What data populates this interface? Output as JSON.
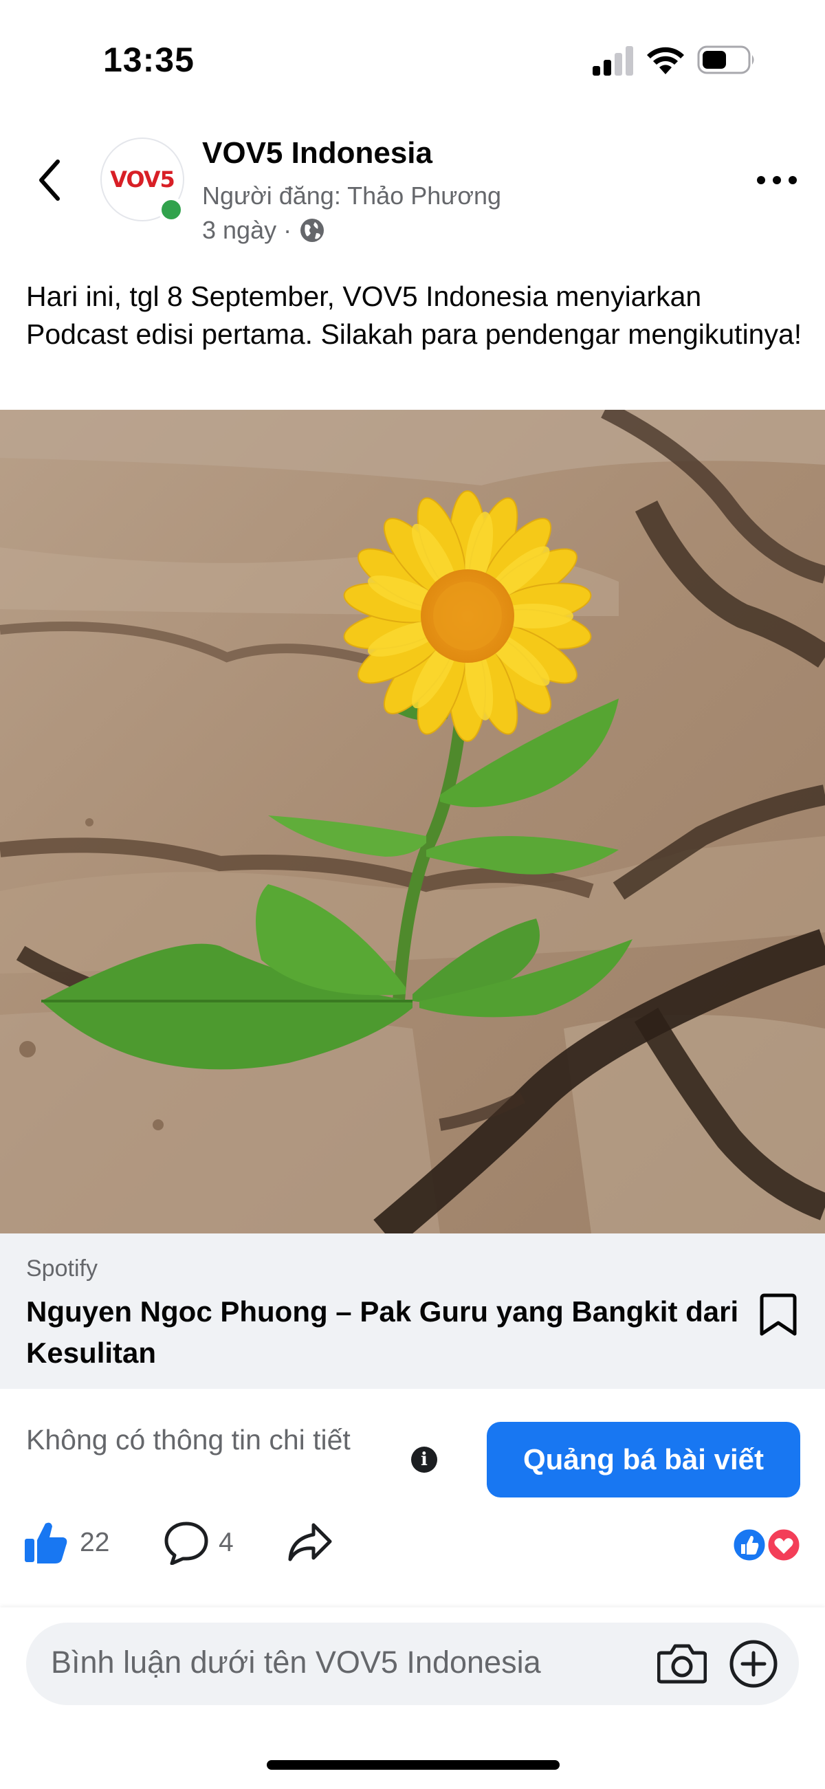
{
  "status_bar": {
    "time": "13:35",
    "signal_icon": "cellular-signal-icon",
    "wifi_icon": "wifi-icon",
    "battery_icon": "battery-icon",
    "battery_level": 0.55
  },
  "header": {
    "back_icon": "chevron-left-icon",
    "avatar_logo_text": "VOV5",
    "page_name": "VOV5 Indonesia",
    "posted_by": "Người đăng: Thảo Phương",
    "post_age": "3 ngày",
    "separator": "·",
    "privacy_icon": "globe-icon",
    "more_icon": "more-horizontal-icon",
    "online_color": "#31a24c"
  },
  "post": {
    "text": "Hari ini, tgl 8 September, VOV5 Indonesia menyiarkan Podcast edisi pertama. Silakah para pendengar mengikutinya!",
    "image_subject": "flower-photo"
  },
  "link_preview": {
    "source": "Spotify",
    "title": "Nguyen Ngoc Phuong – Pak Guru yang Bangkit dari Kesulitan",
    "bookmark_icon": "bookmark-icon"
  },
  "boost": {
    "no_info_text": "Không có thông tin chi tiết",
    "info_icon_glyph": "i",
    "button_label": "Quảng bá bài viết",
    "button_color": "#1877f2"
  },
  "reactions": {
    "like_count": "22",
    "comment_count": "4",
    "like_icon": "thumbs-up-icon",
    "comment_icon": "comment-bubble-icon",
    "share_icon": "share-arrow-icon",
    "summary_icons": [
      "like-reaction-icon",
      "love-reaction-icon"
    ]
  },
  "composer": {
    "placeholder": "Bình luận dưới tên VOV5 Indonesia",
    "camera_icon": "camera-icon",
    "add_icon": "plus-circle-icon"
  }
}
